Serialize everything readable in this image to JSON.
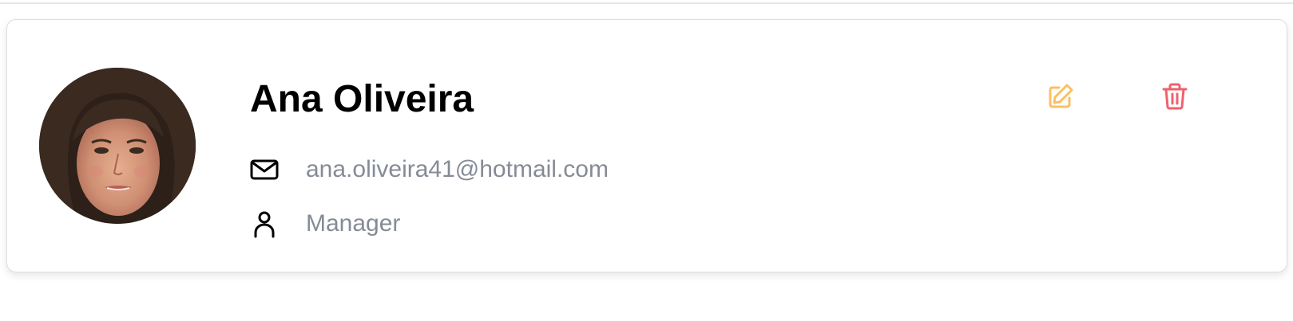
{
  "user_card": {
    "name": "Ana Oliveira",
    "email": "ana.oliveira41@hotmail.com",
    "role": "Manager"
  },
  "icons": {
    "email": "mail-icon",
    "role": "user-icon",
    "edit": "edit-icon",
    "delete": "trash-icon"
  },
  "colors": {
    "edit_icon": "#fcbf63",
    "delete_icon": "#f0616b",
    "secondary_text": "#858b96"
  }
}
